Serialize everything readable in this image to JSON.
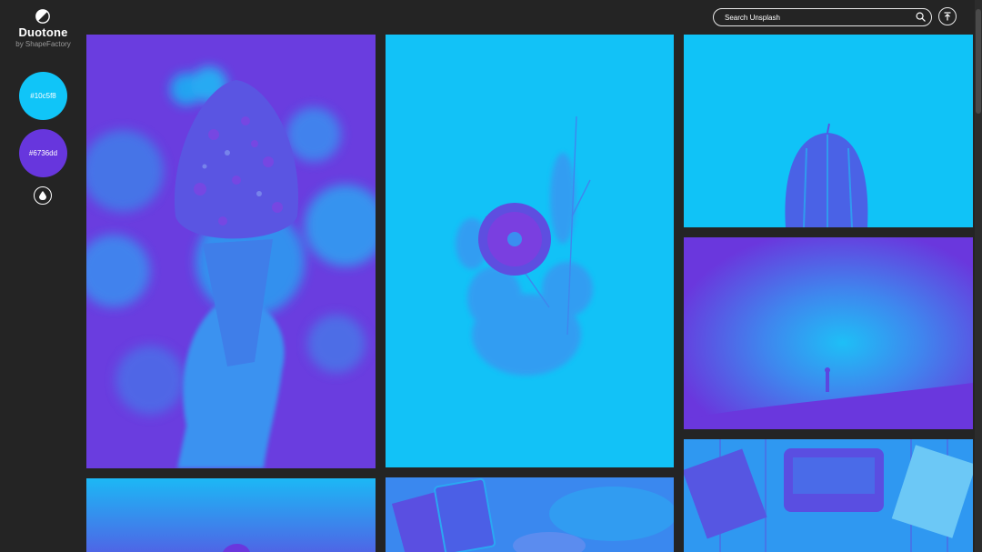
{
  "brand": {
    "title": "Duotone",
    "subtitle": "by ShapeFactory",
    "logo_icon": "half-circle-logo-icon"
  },
  "colors": {
    "primary": "#10c5f8",
    "secondary": "#6736dd",
    "background": "#242424"
  },
  "swatches": [
    {
      "label": "#10c5f8",
      "color": "#10c5f8"
    },
    {
      "label": "#6736dd",
      "color": "#6736dd"
    }
  ],
  "controls": {
    "drop_icon": "water-drop-icon",
    "top_icon": "arrow-up-to-top-icon"
  },
  "search": {
    "placeholder": "Search Unsplash",
    "value": "",
    "icon": "search-icon"
  },
  "photos": [
    {
      "subject": "ice-cream-cone"
    },
    {
      "subject": "flower-bouquet"
    },
    {
      "subject": "cactus"
    },
    {
      "subject": "person-under-night-sky"
    },
    {
      "subject": "typewriter-desk"
    },
    {
      "subject": "gradient-sky"
    },
    {
      "subject": "tablet-hands"
    }
  ]
}
